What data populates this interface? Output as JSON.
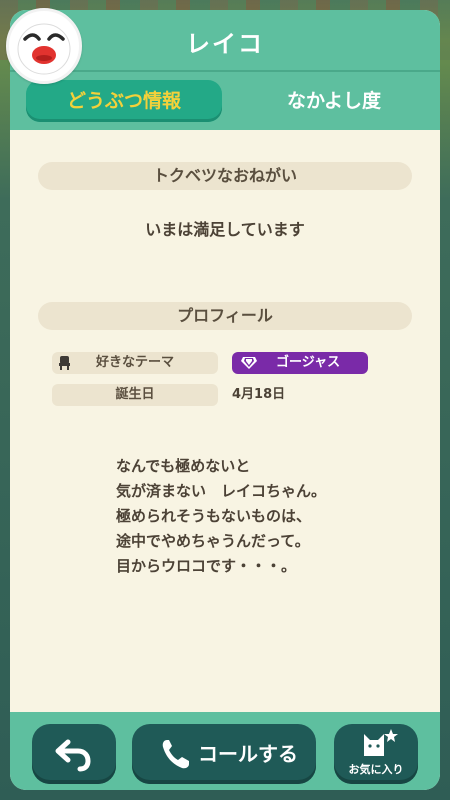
{
  "header": {
    "title": "レイコ",
    "avatar_icon": "penguin-avatar-icon",
    "tabs": [
      {
        "label": "どうぶつ情報",
        "active": true
      },
      {
        "label": "なかよし度",
        "active": false
      }
    ]
  },
  "request_section": {
    "heading": "トクベツなおねがい",
    "text": "いまは満足しています"
  },
  "profile_section": {
    "heading": "プロフィール",
    "rows": [
      {
        "label": "好きなテーマ",
        "icon": "chair-icon",
        "value": "ゴージャス",
        "value_icon": "diamond-icon"
      },
      {
        "label": "誕生日",
        "value": "4月18日"
      }
    ]
  },
  "bio": {
    "lines": [
      "なんでも極めないと",
      "気が済まない　レイコちゃん。",
      "極められそうもないものは、",
      "途中でやめちゃうんだって。",
      "目からウロコです・・・。"
    ]
  },
  "footer": {
    "back_icon": "back-arrow-icon",
    "call_label": "コールする",
    "call_icon": "phone-icon",
    "favorite_label": "お気に入り",
    "favorite_icon": "cat-star-icon"
  },
  "colors": {
    "header_green": "#5ebf9f",
    "tab_active_bg": "#23a987",
    "tab_active_text": "#f3d13a",
    "panel_bg": "#f8f4e3",
    "section_bar": "#ece4cf",
    "theme_badge": "#7a2aa8",
    "button_dark": "#1f5a57"
  }
}
